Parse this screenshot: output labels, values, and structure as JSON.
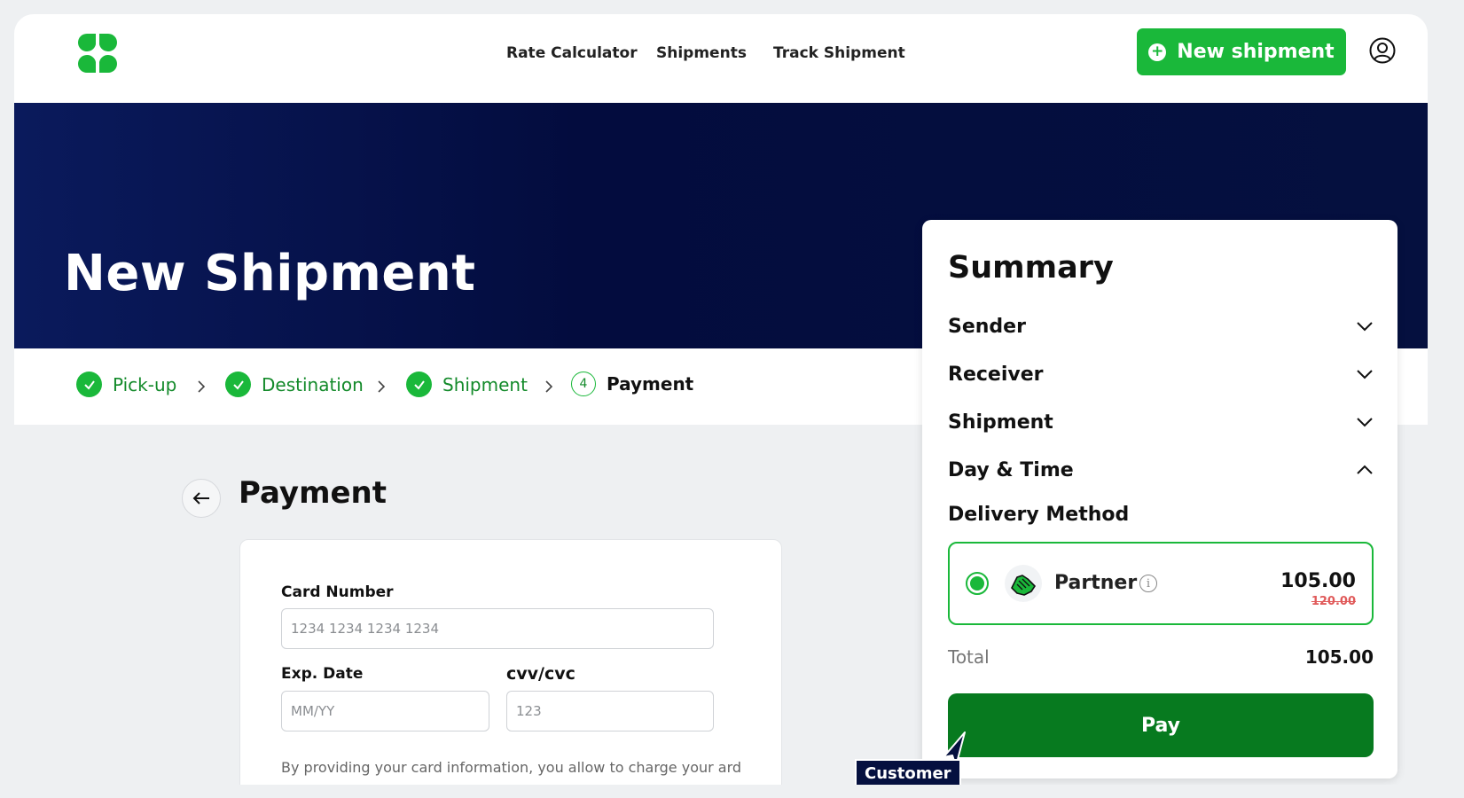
{
  "nav": {
    "items": [
      "Rate Calculator",
      "Shipments",
      "Track Shipment"
    ],
    "new_shipment_label": "New shipment"
  },
  "hero": {
    "title": "New Shipment"
  },
  "steps": [
    {
      "label": "Pick-up",
      "state": "done"
    },
    {
      "label": "Destination",
      "state": "done"
    },
    {
      "label": "Shipment",
      "state": "done"
    },
    {
      "number": "4",
      "label": "Payment",
      "state": "active"
    }
  ],
  "payment": {
    "title": "Payment",
    "card_number_label": "Card Number",
    "card_number_placeholder": "1234 1234 1234 1234",
    "exp_label": "Exp. Date",
    "exp_placeholder": "MM/YY",
    "cvv_label": "cvv/cvc",
    "cvv_placeholder": "123",
    "disclaimer": "By providing your card information, you allow to charge your ard"
  },
  "summary": {
    "title": "Summary",
    "sections": [
      {
        "label": "Sender",
        "expanded": false
      },
      {
        "label": "Receiver",
        "expanded": false
      },
      {
        "label": "Shipment",
        "expanded": false
      },
      {
        "label": "Day & Time",
        "expanded": true
      }
    ],
    "delivery_method_label": "Delivery Method",
    "option": {
      "label": "Partner",
      "price": "105.00",
      "old_price": "120.00",
      "selected": true
    },
    "total_label": "Total",
    "total_value": "105.00",
    "pay_label": "Pay"
  },
  "cursor_tag": "Customer",
  "colors": {
    "brand_green": "#1ab83a",
    "pay_green": "#077a1f",
    "hero_navy": "#05103f",
    "strike_red": "#e05a5a"
  }
}
